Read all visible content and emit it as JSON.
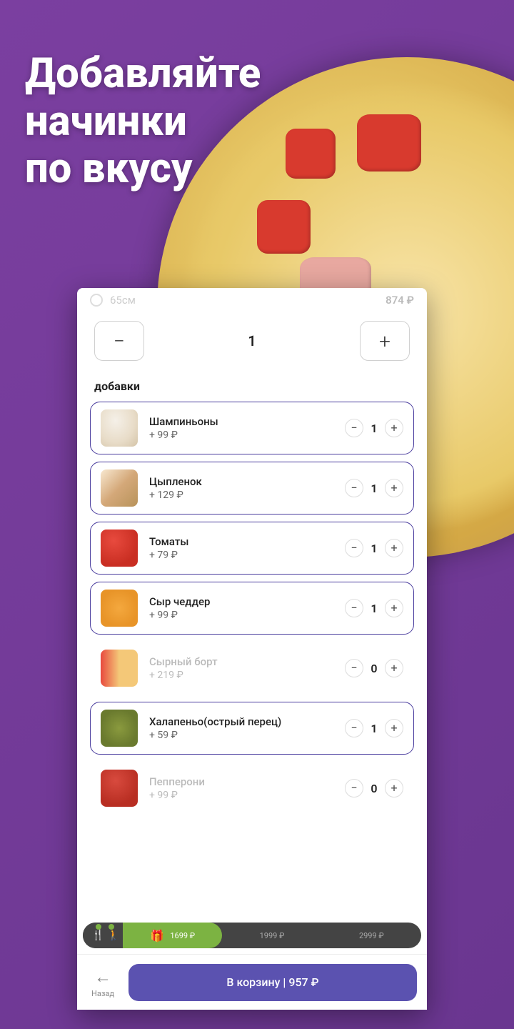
{
  "headline": {
    "line1": "Добавляйте",
    "line2": "начинки",
    "line3": "по вкусу"
  },
  "size": {
    "label": "65см",
    "price": "874 ₽"
  },
  "quantity": {
    "value": "1"
  },
  "addons_title": "добавки",
  "addons": [
    {
      "name": "Шампиньоны",
      "price": "+ 99 ₽",
      "qty": "1",
      "active": true,
      "img": "mushroom"
    },
    {
      "name": "Цыпленок",
      "price": "+ 129 ₽",
      "qty": "1",
      "active": true,
      "img": "chicken"
    },
    {
      "name": "Томаты",
      "price": "+ 79 ₽",
      "qty": "1",
      "active": true,
      "img": "tomato"
    },
    {
      "name": "Сыр чеддер",
      "price": "+ 99 ₽",
      "qty": "1",
      "active": true,
      "img": "cheddar"
    },
    {
      "name": "Сырный борт",
      "price": "+ 219 ₽",
      "qty": "0",
      "active": false,
      "img": "cheese-crust"
    },
    {
      "name": "Халапеньо(острый перец)",
      "price": "+ 59 ₽",
      "qty": "1",
      "active": true,
      "img": "jalapeno"
    },
    {
      "name": "Пепперони",
      "price": "+ 99 ₽",
      "qty": "0",
      "active": false,
      "img": "pepperoni"
    }
  ],
  "progress": {
    "tier1": "1699 ₽",
    "tier2": "1999 ₽",
    "tier3": "2999 ₽"
  },
  "bottom": {
    "back": "Назад",
    "cart": "В корзину | 957 ₽"
  }
}
